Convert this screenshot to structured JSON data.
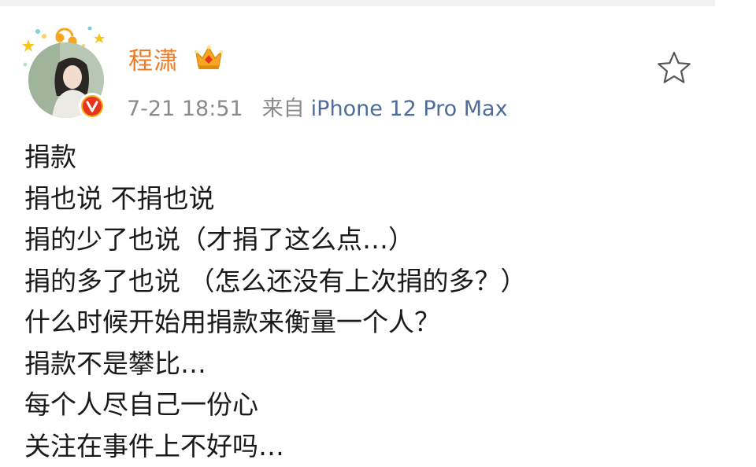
{
  "post": {
    "author": {
      "name": "程潇",
      "avatar": "avatar-photo",
      "verified_icon": "verified-v-badge-icon",
      "vip_icon": "crown-icon"
    },
    "meta": {
      "time": "7-21 18:51",
      "from_label": "来自",
      "device": "iPhone 12 Pro Max"
    },
    "favorite_icon": "star-icon",
    "content_lines": [
      "捐款",
      "捐也说 不捐也说",
      "捐的少了也说（才捐了这么点…）",
      "捐的多了也说 （怎么还没有上次捐的多？）",
      "什么时候开始用捐款来衡量一个人？",
      "捐款不是攀比…",
      "每个人尽自己一份心",
      "关注在事件上不好吗…"
    ]
  },
  "colors": {
    "username": "#f07a1f",
    "device_link": "#4d6c9a",
    "meta_text": "#8a8a8a",
    "verified_badge": "#e8331d",
    "crown": "#f5a623"
  }
}
